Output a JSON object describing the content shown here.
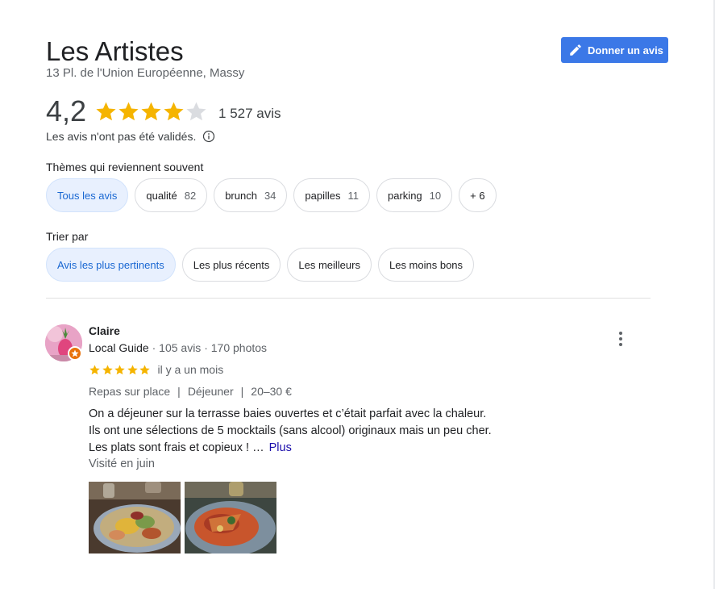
{
  "place": {
    "name": "Les Artistes",
    "address": "13 Pl. de l'Union Européenne, Massy"
  },
  "write_review_button": {
    "label": "Donner un avis",
    "icon": "pencil-icon"
  },
  "rating": {
    "value_text": "4,2",
    "value": 4.2,
    "max_stars": 5,
    "count_text": "1 527 avis",
    "disclaimer": "Les avis n'ont pas été validés.",
    "star_color": "#f5b400",
    "empty_star_color": "#dadce0"
  },
  "themes": {
    "label": "Thèmes qui reviennent souvent",
    "chips": [
      {
        "label": "Tous les avis",
        "count": "",
        "selected": true
      },
      {
        "label": "qualité",
        "count": "82",
        "selected": false
      },
      {
        "label": "brunch",
        "count": "34",
        "selected": false
      },
      {
        "label": "papilles",
        "count": "11",
        "selected": false
      },
      {
        "label": "parking",
        "count": "10",
        "selected": false
      },
      {
        "label": "+ 6",
        "count": "",
        "selected": false
      }
    ]
  },
  "sort": {
    "label": "Trier par",
    "chips": [
      {
        "label": "Avis les plus pertinents",
        "selected": true
      },
      {
        "label": "Les plus récents",
        "selected": false
      },
      {
        "label": "Les meilleurs",
        "selected": false
      },
      {
        "label": "Les moins bons",
        "selected": false
      }
    ]
  },
  "review": {
    "author": "Claire",
    "guide_label": "Local Guide",
    "stats": "· 105 avis · 170 photos",
    "stars": 5,
    "date": "il y a un mois",
    "tags": [
      "Repas sur place",
      "Déjeuner",
      "20–30 €"
    ],
    "tag_separator": "|",
    "text_lines": [
      "On a déjeuner sur la terrasse baies ouvertes et c’était parfait avec la chaleur.",
      "Ils ont une sélections de 5 mocktails (sans alcool) originaux mais un peu cher.",
      "Les plats sont frais et copieux ! …"
    ],
    "more_link": "Plus",
    "visited": "Visité en juin",
    "photos": [
      "food-photo-salad",
      "food-photo-dish"
    ]
  },
  "colors": {
    "accent_blue": "#3b78e7",
    "chip_selected_bg": "#e8f0fe",
    "chip_selected_text": "#1967d2",
    "link": "#1a0dab",
    "guide_badge": "#e8710a"
  }
}
